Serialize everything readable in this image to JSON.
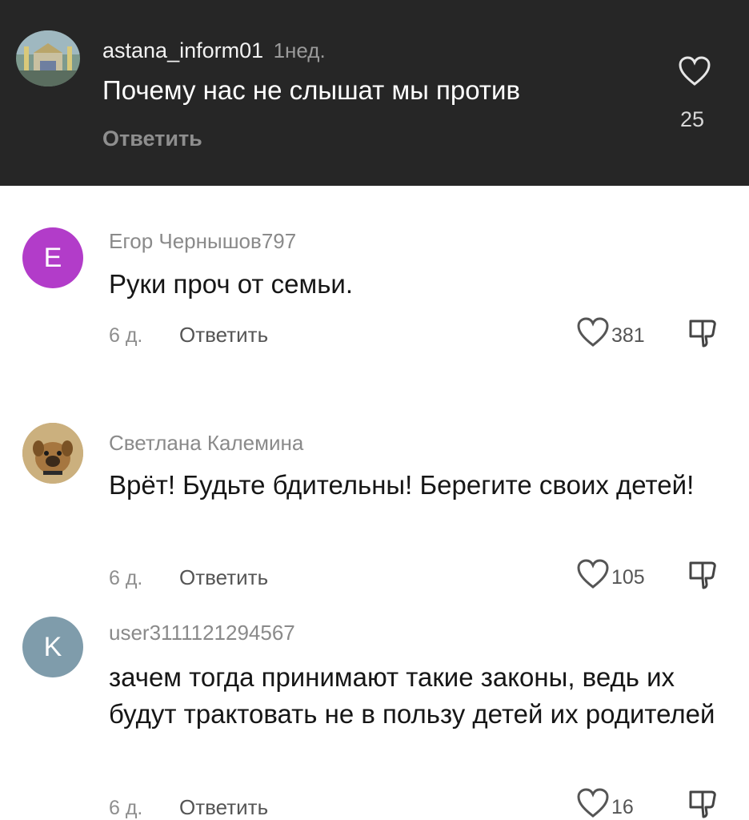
{
  "colors": {
    "dark_background": "#262626",
    "avatar_e": "#b23cc9",
    "avatar_k": "#7f9cab"
  },
  "featured_comment": {
    "username": "astana_inform01",
    "time": "1нед.",
    "text": "Почему нас не слышат мы против",
    "reply_label": "Ответить",
    "likes": "25",
    "avatar_icon": "building-photo-avatar",
    "like_icon": "heart-outline-icon"
  },
  "comments": [
    {
      "username": "Егор Чернышов797",
      "avatar_letter": "Е",
      "text": "Руки проч от семьи.",
      "time": "6 д.",
      "reply_label": "Ответить",
      "likes": "381",
      "like_icon": "heart-outline-icon",
      "dislike_icon": "thumbs-down-icon"
    },
    {
      "username": "Светлана Калемина",
      "avatar_icon": "dog-photo-avatar",
      "text": "Врёт! Будьте бдительны! Берегите своих детей!",
      "time": "6 д.",
      "reply_label": "Ответить",
      "likes": "105",
      "like_icon": "heart-outline-icon",
      "dislike_icon": "thumbs-down-icon"
    },
    {
      "username": "user3111121294567",
      "avatar_letter": "K",
      "text": "зачем тогда принимают такие законы, ведь их будут трактовать не в пользу детей их родителей",
      "time": "6 д.",
      "reply_label": "Ответить",
      "likes": "16",
      "like_icon": "heart-outline-icon",
      "dislike_icon": "thumbs-down-icon"
    }
  ]
}
